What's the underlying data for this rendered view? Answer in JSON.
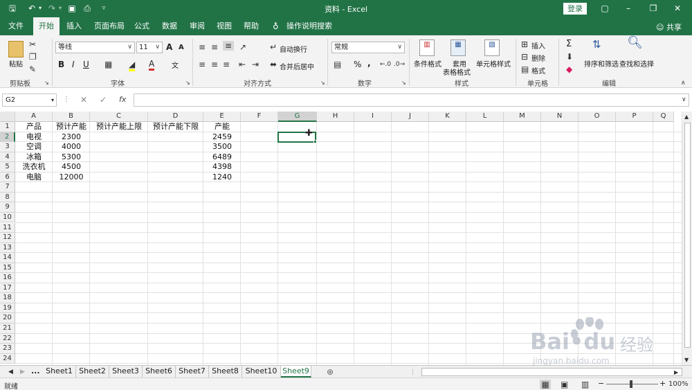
{
  "window": {
    "title": "资料 - Excel",
    "login_label": "登录"
  },
  "ribbon_tabs": [
    "文件",
    "开始",
    "插入",
    "页面布局",
    "公式",
    "数据",
    "审阅",
    "视图",
    "帮助"
  ],
  "tell_me": "操作说明搜索",
  "share_label": "共享",
  "clipboard": {
    "paste_label": "粘贴",
    "group_label": "剪贴板"
  },
  "font": {
    "name": "等线",
    "size": "11",
    "group_label": "字体",
    "bold": "B",
    "italic": "I",
    "underline": "U",
    "grow": "A",
    "shrink": "A",
    "phonetic": "文",
    "font_color_letter": "A"
  },
  "alignment": {
    "wrap_label": "自动换行",
    "merge_label": "合并后居中",
    "group_label": "对齐方式"
  },
  "number": {
    "format": "常规",
    "group_label": "数字",
    "percent": "%",
    "comma": ","
  },
  "styles": {
    "conditional_label": "条件格式",
    "table_label_1": "套用",
    "table_label_2": "表格格式",
    "cell_style_label": "单元格样式",
    "group_label": "样式"
  },
  "cells": {
    "insert_label": "插入",
    "delete_label": "删除",
    "format_label": "格式",
    "group_label": "单元格"
  },
  "editing": {
    "sort_label": "排序和筛选",
    "find_label": "查找和选择",
    "group_label": "编辑",
    "sum_symbol": "Σ"
  },
  "formula_bar": {
    "name_box": "G2",
    "formula": "",
    "cancel": "✕",
    "enter": "✓",
    "fx": "fx"
  },
  "columns": [
    "A",
    "B",
    "C",
    "D",
    "E",
    "F",
    "G",
    "H",
    "I",
    "J",
    "K",
    "L",
    "M",
    "N",
    "O",
    "P",
    "Q"
  ],
  "row_numbers": [
    "1",
    "2",
    "3",
    "4",
    "5",
    "6",
    "7",
    "8",
    "9",
    "10",
    "11",
    "12",
    "13",
    "14",
    "15",
    "16",
    "17",
    "18",
    "19",
    "20",
    "21",
    "22",
    "23",
    "24"
  ],
  "table": {
    "headers": [
      "产品",
      "预计产能",
      "预计产能上限",
      "预计产能下限",
      "产能"
    ],
    "rows": [
      [
        "电视",
        "2300",
        "",
        "",
        "2459"
      ],
      [
        "空调",
        "4000",
        "",
        "",
        "3500"
      ],
      [
        "冰箱",
        "5300",
        "",
        "",
        "6489"
      ],
      [
        "洗衣机",
        "4500",
        "",
        "",
        "4398"
      ],
      [
        "电脑",
        "12000",
        "",
        "",
        "1240"
      ]
    ]
  },
  "selected_cell": "G2",
  "sheets": [
    "Sheet1",
    "Sheet2",
    "Sheet3",
    "Sheet6",
    "Sheet7",
    "Sheet8",
    "Sheet10",
    "Sheet9"
  ],
  "active_sheet": "Sheet9",
  "sheet_nav_more": "...",
  "status": {
    "ready": "就绪",
    "zoom": "100%",
    "zoom_minus": "−",
    "zoom_plus": "+"
  },
  "watermark": {
    "brand": "Bai",
    "brand2": "du",
    "cn": "经验",
    "url": "jingyan.baidu.com"
  },
  "colors": {
    "excel_green": "#217346",
    "ribbon_bg": "#f3f3f3"
  }
}
